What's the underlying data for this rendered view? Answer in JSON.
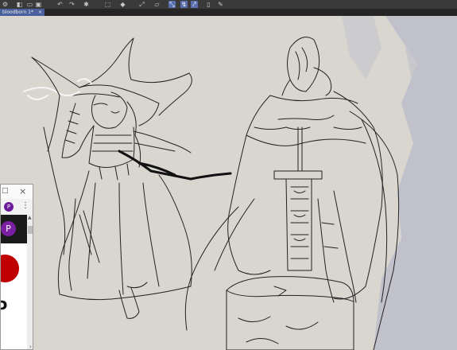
{
  "toolbar": {
    "icons": [
      "gear-icon",
      "layers-icon",
      "folder-icon",
      "save-icon",
      "undo-icon",
      "redo-icon",
      "settings-icon",
      "transform-icon",
      "fill-icon",
      "select-icon",
      "lasso-icon",
      "select-active-icon",
      "pen-select-icon",
      "brush-select-icon",
      "file-icon",
      "pen-icon"
    ]
  },
  "tab": {
    "label": "bloodborn 1*",
    "close": "×"
  },
  "browser": {
    "minimize_glyph": "□",
    "close_glyph": "×",
    "avatar_letter": "P",
    "menu_glyph": "⋮",
    "glyph_text": "ɔ"
  },
  "colors": {
    "canvas_bg": "#d8d6cf",
    "ink": "#222222",
    "accent": "#5a6fb0",
    "brand_purple": "#7b1fa2",
    "red": "#c00000",
    "ghost_figure": "#aeb0c8"
  }
}
